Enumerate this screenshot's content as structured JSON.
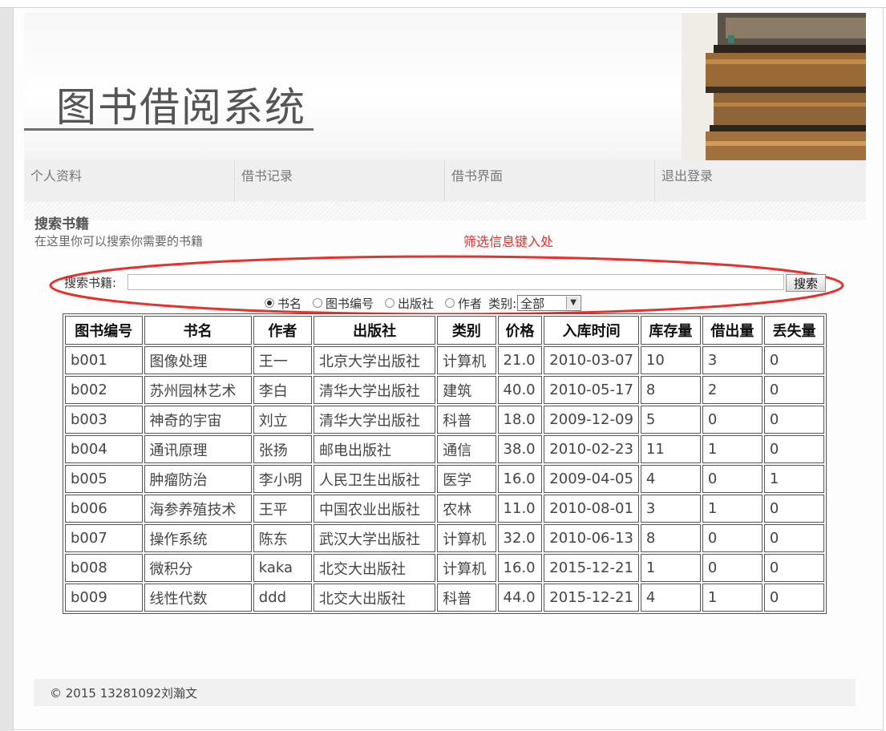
{
  "app": {
    "title": "图书借阅系统"
  },
  "nav": [
    {
      "label": "个人资料"
    },
    {
      "label": "借书记录"
    },
    {
      "label": "借书界面"
    },
    {
      "label": "退出登录"
    }
  ],
  "section": {
    "title": "搜索书籍",
    "subtitle": "在这里你可以搜索你需要的书籍",
    "annotation": "筛选信息键入处"
  },
  "search": {
    "label": "搜索书籍:",
    "value": "",
    "button_label": "搜索"
  },
  "filters": {
    "options": [
      {
        "label": "书名",
        "checked": true
      },
      {
        "label": "图书编号",
        "checked": false
      },
      {
        "label": "出版社",
        "checked": false
      },
      {
        "label": "作者",
        "checked": false
      }
    ],
    "category_label": "类别:",
    "category_value": "全部"
  },
  "colors": {
    "annotation": "#e8302d",
    "ellipse": "#e8302d"
  },
  "table": {
    "headers": [
      "图书编号",
      "书名",
      "作者",
      "出版社",
      "类别",
      "价格",
      "入库时间",
      "库存量",
      "借出量",
      "丢失量"
    ],
    "rows": [
      [
        "b001",
        "图像处理",
        "王一",
        "北京大学出版社",
        "计算机",
        "21.0",
        "2010-03-07",
        "10",
        "3",
        "0"
      ],
      [
        "b002",
        "苏州园林艺术",
        "李白",
        "清华大学出版社",
        "建筑",
        "40.0",
        "2010-05-17",
        "8",
        "2",
        "0"
      ],
      [
        "b003",
        "神奇的宇宙",
        "刘立",
        "清华大学出版社",
        "科普",
        "18.0",
        "2009-12-09",
        "5",
        "0",
        "0"
      ],
      [
        "b004",
        "通讯原理",
        "张扬",
        "邮电出版社",
        "通信",
        "38.0",
        "2010-02-23",
        "11",
        "1",
        "0"
      ],
      [
        "b005",
        "肿瘤防治",
        "李小明",
        "人民卫生出版社",
        "医学",
        "16.0",
        "2009-04-05",
        "4",
        "0",
        "1"
      ],
      [
        "b006",
        "海参养殖技术",
        "王平",
        "中国农业出版社",
        "农林",
        "11.0",
        "2010-08-01",
        "3",
        "1",
        "0"
      ],
      [
        "b007",
        "操作系统",
        "陈东",
        "武汉大学出版社",
        "计算机",
        "32.0",
        "2010-06-13",
        "8",
        "0",
        "0"
      ],
      [
        "b008",
        "微积分",
        "kaka",
        "北交大出版社",
        "计算机",
        "16.0",
        "2015-12-21",
        "1",
        "0",
        "0"
      ],
      [
        "b009",
        "线性代数",
        "ddd",
        "北交大出版社",
        "科普",
        "44.0",
        "2015-12-21",
        "4",
        "1",
        "0"
      ]
    ]
  },
  "footer": {
    "text": "© 2015  13281092刘瀚文"
  }
}
